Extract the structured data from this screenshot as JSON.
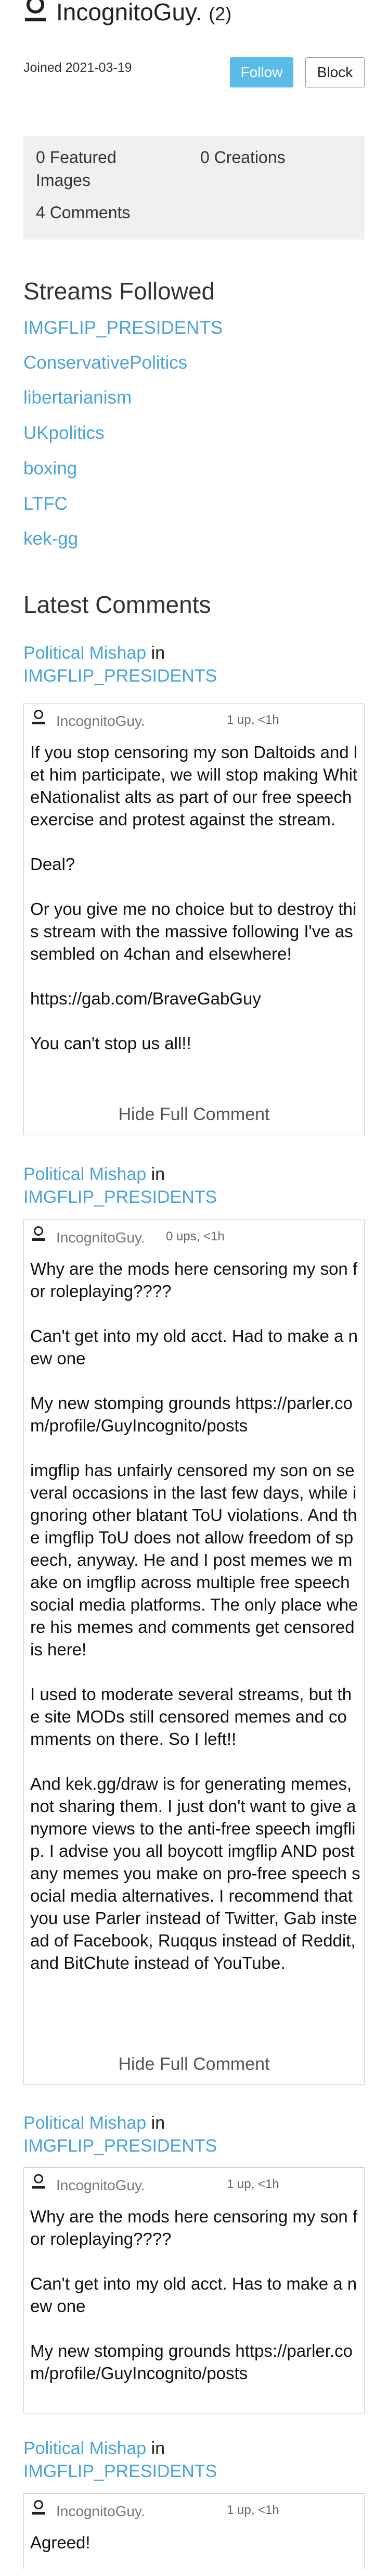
{
  "profile": {
    "username": "IncognitoGuy.",
    "count": "(2)",
    "joined": "Joined 2021-03-19",
    "follow_label": "Follow",
    "block_label": "Block"
  },
  "stats": {
    "featured": "0 Featured Images",
    "creations": "0 Creations",
    "comments": "4 Comments"
  },
  "streams": {
    "heading": "Streams Followed",
    "items": [
      "IMGFLIP_PRESIDENTS",
      "ConservativePolitics",
      "libertarianism",
      "UKpolitics",
      "boxing",
      "LTFC",
      "kek-gg"
    ]
  },
  "latest": {
    "heading": "Latest Comments",
    "comments": [
      {
        "post": "Political Mishap",
        "in": "in",
        "stream": "IMGFLIP_PRESIDENTS",
        "user": "IncognitoGuy.",
        "ups": "1 up, <1h",
        "text": "If you stop censoring my son Daltoids and let him participate, we will stop making WhiteNationalist alts as part of our free speech exercise and protest against the stream.\n\nDeal?\n\nOr you give me no choice but to destroy this stream with the massive following I've assembled on 4chan and elsewhere!\n\nhttps://gab.com/BraveGabGuy\n\nYou can't stop us all!!",
        "hide": "Hide Full Comment"
      },
      {
        "post": "Political Mishap",
        "in": "in",
        "stream": "IMGFLIP_PRESIDENTS",
        "user": "IncognitoGuy.",
        "ups": "0 ups, <1h",
        "text": "Why are the mods here censoring my son for roleplaying????\n\nCan't get into my old acct. Had to make a new one\n\nMy new stomping grounds https://parler.com/profile/GuyIncognito/posts\n\nimgflip has unfairly censored my son on several occasions in the last few days, while ignoring other blatant ToU violations. And the imgflip ToU does not allow freedom of speech, anyway. He and I post memes we make on imgflip across multiple free speech social media platforms. The only place where his memes and comments get censored is here!\n\nI used to moderate several streams, but the site MODs still censored memes and comments on there. So I left!!\n\nAnd kek.gg/draw is for generating memes, not sharing them. I just don't want to give anymore views to the anti-free speech imgflip. I advise you all boycott imgflip AND post any memes you make on pro-free speech social media alternatives. I recommend that you use Parler instead of Twitter, Gab instead of Facebook, Ruqqus instead of Reddit, and BitChute instead of YouTube.",
        "hide": "Hide Full Comment"
      },
      {
        "post": "Political Mishap",
        "in": "in",
        "stream": "IMGFLIP_PRESIDENTS",
        "user": "IncognitoGuy.",
        "ups": "1 up, <1h",
        "text": "Why are the mods here censoring my son for roleplaying????\n\nCan't get into my old acct. Has to make a new one\n\nMy new stomping grounds https://parler.com/profile/GuyIncognito/posts",
        "hide": ""
      },
      {
        "post": "Political Mishap",
        "in": "in",
        "stream": "IMGFLIP_PRESIDENTS",
        "user": "IncognitoGuy.",
        "ups": "1 up, <1h",
        "text": "Agreed!",
        "hide": ""
      }
    ]
  },
  "colors": {
    "link": "#4aa3d8",
    "follow_bg": "#5bbcea",
    "stats_bg": "#f0f0f0"
  }
}
